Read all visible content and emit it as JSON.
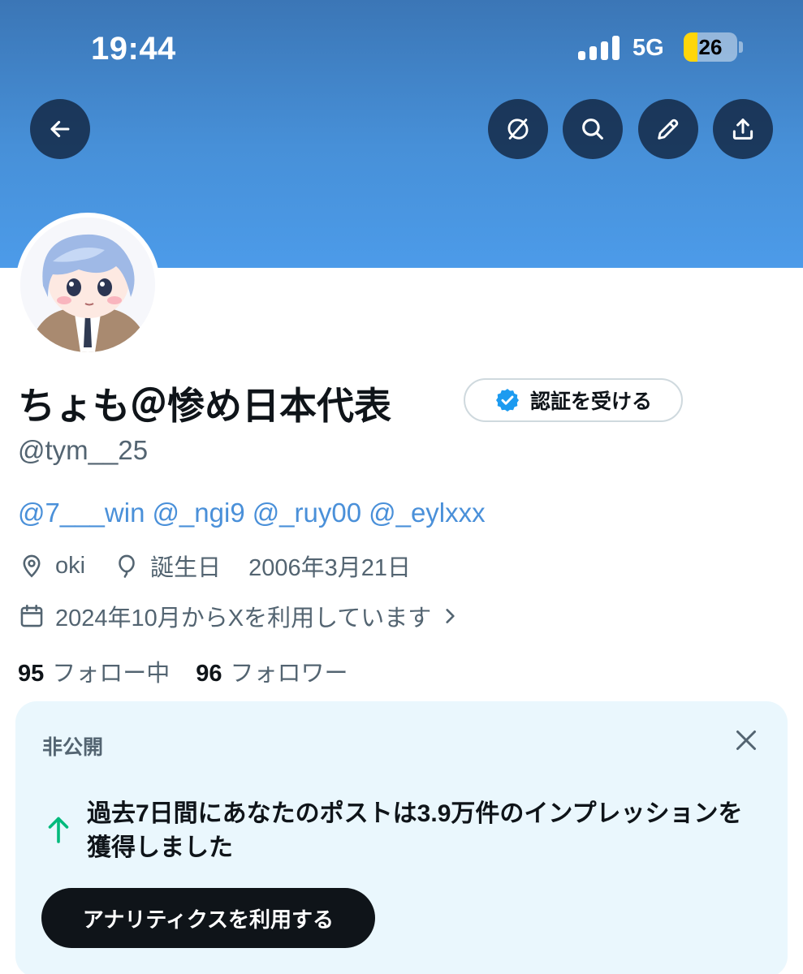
{
  "status_bar": {
    "time": "19:44",
    "network": "5G",
    "battery_level": "26",
    "battery_fraction": 0.26,
    "signal_bars": 4
  },
  "header": {
    "buttons": [
      {
        "icon": "back-arrow-icon"
      },
      {
        "icon": "grok-icon"
      },
      {
        "icon": "search-icon"
      },
      {
        "icon": "edit-pencil-icon"
      },
      {
        "icon": "share-icon"
      }
    ],
    "banner_color": "#4c9be9"
  },
  "profile": {
    "display_name": "ちょも＠惨め日本代表",
    "verify_label": "認証を受ける",
    "handle": "@tym__25",
    "bio_mentions": [
      "@7___win",
      "@_ngi9",
      "@_ruy00",
      "@_eylxxx"
    ],
    "location": "oki",
    "birthday_label": "誕生日",
    "birthday": "2006年3月21日",
    "joined": "2024年10月からXを利用しています",
    "following_count": "95",
    "following_label": "フォロー中",
    "followers_count": "96",
    "followers_label": "フォロワー"
  },
  "card": {
    "title": "非公開",
    "message": "過去7日間にあなたのポストは3.9万件のインプレッションを獲得しました",
    "button_label": "アナリティクスを利用する",
    "arrow_color": "#00ba7c"
  },
  "colors": {
    "accent": "#1d9bf0",
    "text": "#0f1419",
    "muted": "#536471"
  }
}
